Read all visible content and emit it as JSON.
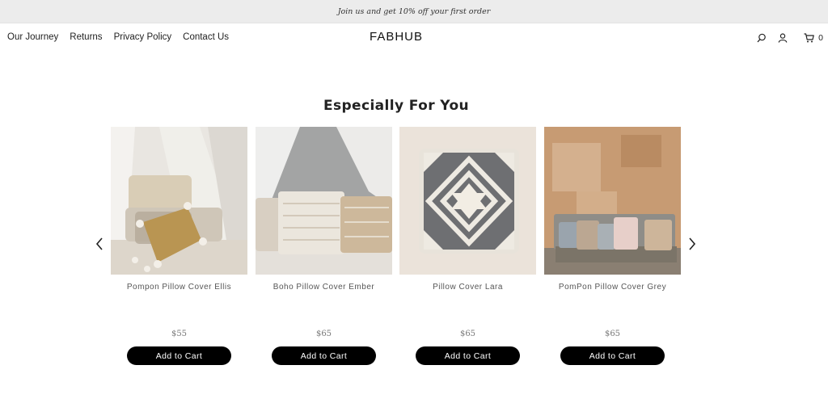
{
  "announcement": "Join us and get 10% off your first order",
  "nav": {
    "items": [
      "Our Journey",
      "Returns",
      "Privacy Policy",
      "Contact Us"
    ]
  },
  "brand": "FABHUB",
  "header_icons": [
    "search-icon",
    "account-icon",
    "cart-icon"
  ],
  "cart": {
    "count": "0"
  },
  "section": {
    "title": "Especially For You"
  },
  "products": [
    {
      "name": "Pompon Pillow Cover Ellis",
      "price": "$55",
      "button": "Add to Cart"
    },
    {
      "name": "Boho Pillow Cover Ember",
      "price": "$65",
      "button": "Add to Cart"
    },
    {
      "name": "Pillow Cover Lara",
      "price": "$65",
      "button": "Add to Cart"
    },
    {
      "name": "PomPon Pillow Cover Grey",
      "price": "$65",
      "button": "Add to Cart"
    }
  ],
  "carousel": {
    "prev_icon": "chevron-left-icon",
    "next_icon": "chevron-right-icon"
  },
  "colors": {
    "announcement_bg": "#ececec",
    "button_bg": "#000000",
    "button_text": "#ffffff"
  }
}
